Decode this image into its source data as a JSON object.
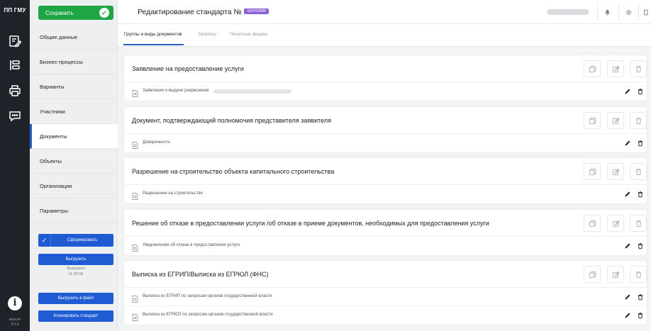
{
  "app": {
    "name": "ПП ГМУ",
    "version_line1": "версия",
    "version_line2": "5.0.0"
  },
  "header": {
    "save_label": "Сохранить",
    "title": "Редактирование стандарта №",
    "status_badge": "ЧЕРНОВИК"
  },
  "nav": {
    "items": [
      {
        "label": "Общие данные"
      },
      {
        "label": "Бизнес-процессы"
      },
      {
        "label": "Варианты"
      },
      {
        "label": "Участники"
      },
      {
        "label": "Документы"
      },
      {
        "label": "Объекты"
      },
      {
        "label": "Организации"
      },
      {
        "label": "Параметры"
      }
    ],
    "active_index": 4,
    "form_button": "Сформировать",
    "upload_button": "Выгрузить",
    "upload_meta_line1": "Выгружен",
    "upload_meta_line2": "11:25:05",
    "export_file_button": "Выгрузить в файл",
    "clone_button": "Клонировать стандарт"
  },
  "tabs": [
    {
      "label": "Группы и виды документов",
      "active": true
    },
    {
      "label": "Запросы",
      "active": false
    },
    {
      "label": "Печатные формы",
      "active": false
    }
  ],
  "groups": [
    {
      "title": "Заявление на предоставление услуги",
      "docs": [
        {
          "name": "Заявление о выдаче разрешения"
        }
      ]
    },
    {
      "title": "Документ, подтверждающий полномочия представителя заявителя",
      "docs": [
        {
          "name": "Доверенность"
        }
      ]
    },
    {
      "title": "Разрешение на строительство объекта капитального строительства",
      "docs": [
        {
          "name": "Разрешение на строительство"
        }
      ]
    },
    {
      "title": "Решение об отказе в предоставлении услуги /об отказе в приеме документов, необходимых для предоставления услуги",
      "docs": [
        {
          "name": "Уведомление об отказе в предоставлении услуги"
        }
      ]
    },
    {
      "title": "Выписка из ЕГРИП/Выписка из ЕГРЮЛ (ФНС)",
      "docs": [
        {
          "name": "Выписка из ЕГРИП по запросам органов государственной власти"
        },
        {
          "name": "Выписка из ЕГРЮЛ по запросам органов государственной власти"
        }
      ]
    }
  ],
  "colors": {
    "save_green": "#1fa644",
    "primary_blue": "#1f5bd3",
    "draft_purple": "#8b5fd6",
    "rail_dark": "#1e2229"
  }
}
